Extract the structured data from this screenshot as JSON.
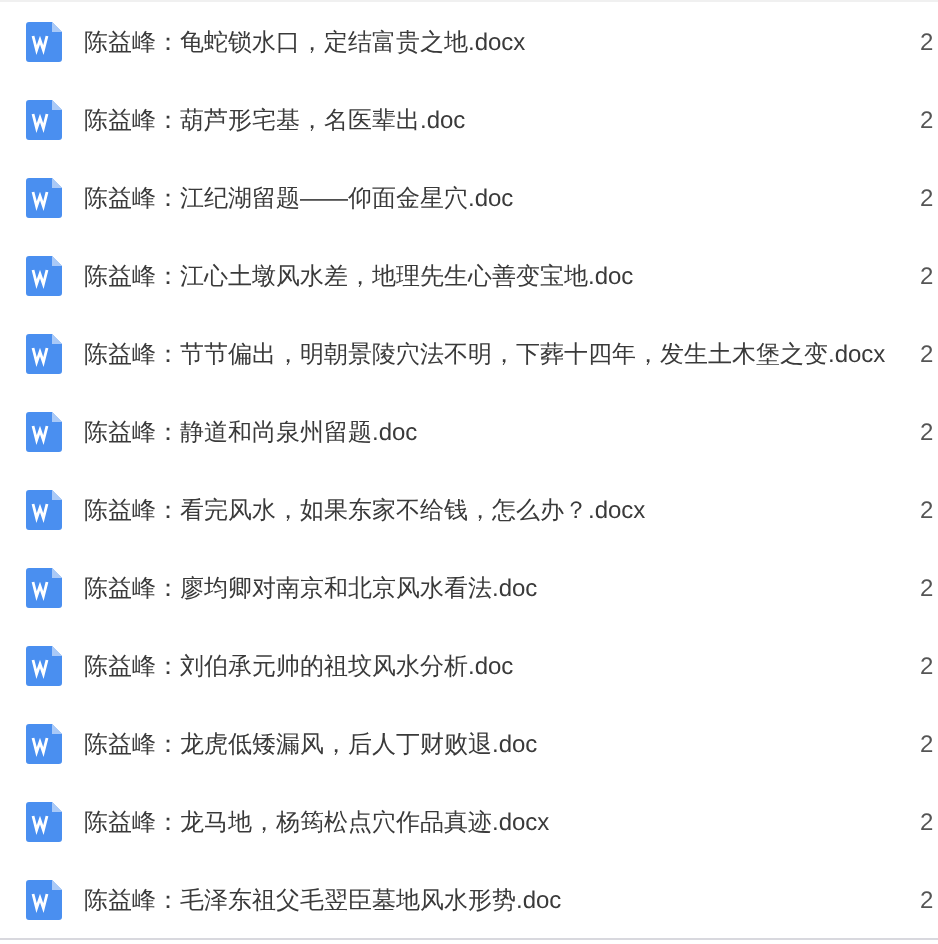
{
  "files": [
    {
      "name": "陈益峰：龟蛇锁水口，定结富贵之地.docx",
      "column_2": "2"
    },
    {
      "name": "陈益峰：葫芦形宅基，名医辈出.doc",
      "column_2": "2"
    },
    {
      "name": "陈益峰：江纪湖留题——仰面金星穴.doc",
      "column_2": "2"
    },
    {
      "name": "陈益峰：江心土墩风水差，地理先生心善变宝地.doc",
      "column_2": "2"
    },
    {
      "name": "陈益峰：节节偏出，明朝景陵穴法不明，下葬十四年，发生土木堡之变.docx",
      "column_2": "2"
    },
    {
      "name": "陈益峰：静道和尚泉州留题.doc",
      "column_2": "2"
    },
    {
      "name": "陈益峰：看完风水，如果东家不给钱，怎么办？.docx",
      "column_2": "2"
    },
    {
      "name": "陈益峰：廖均卿对南京和北京风水看法.doc",
      "column_2": "2"
    },
    {
      "name": "陈益峰：刘伯承元帅的祖坟风水分析.doc",
      "column_2": "2"
    },
    {
      "name": "陈益峰：龙虎低矮漏风，后人丁财败退.doc",
      "column_2": "2"
    },
    {
      "name": "陈益峰：龙马地，杨筠松点穴作品真迹.docx",
      "column_2": "2"
    },
    {
      "name": "陈益峰：毛泽东祖父毛翌臣墓地风水形势.doc",
      "column_2": "2"
    }
  ]
}
